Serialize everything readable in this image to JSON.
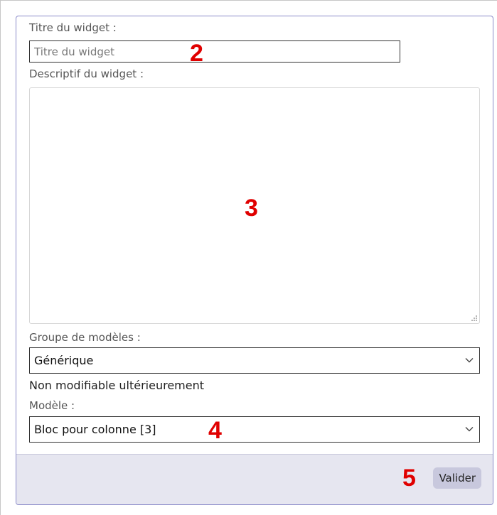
{
  "form": {
    "title_label": "Titre du widget :",
    "title_placeholder": "Titre du widget",
    "title_value": "",
    "description_label": "Descriptif du widget :",
    "description_value": "",
    "group_label": "Groupe de modèles :",
    "group_selected": "Générique",
    "group_note": "Non modifiable ultérieurement",
    "model_label": "Modèle :",
    "model_selected": "Bloc pour colonne [3]",
    "submit_label": "Valider"
  },
  "annotations": {
    "title_marker": "2",
    "description_marker": "3",
    "model_marker": "4",
    "submit_marker": "5"
  },
  "colors": {
    "annotation": "#e00000",
    "panel_border": "#8a8ac9",
    "footer_bg": "#e6e6f0",
    "button_bg": "#c8c8dd"
  }
}
